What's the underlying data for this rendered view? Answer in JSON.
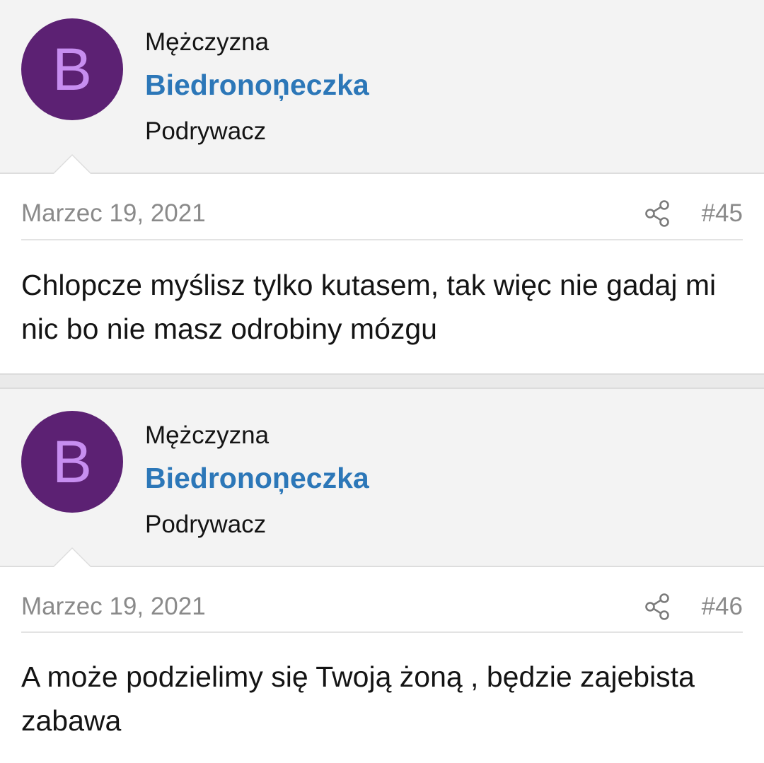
{
  "posts": [
    {
      "avatar_letter": "B",
      "gender": "Mężczyzna",
      "username": "Biedronoņeczka",
      "rank": "Podrywacz",
      "date": "Marzec 19, 2021",
      "post_number": "#45",
      "message": "Chlopcze myślisz tylko kutasem, tak więc nie gadaj mi nic bo nie masz odrobiny mózgu"
    },
    {
      "avatar_letter": "B",
      "gender": "Mężczyzna",
      "username": "Biedronoņeczka",
      "rank": "Podrywacz",
      "date": "Marzec 19, 2021",
      "post_number": "#46",
      "message": "A może podzielimy się Twoją żoną , będzie zajebista zabawa"
    }
  ],
  "colors": {
    "avatar_bg": "#5c2173",
    "avatar_letter": "#c78ef0",
    "username": "#2c77b8",
    "user_block_bg": "#f3f3f3",
    "meta_text": "#8a8a8a"
  },
  "icons": {
    "share": "share-icon"
  }
}
